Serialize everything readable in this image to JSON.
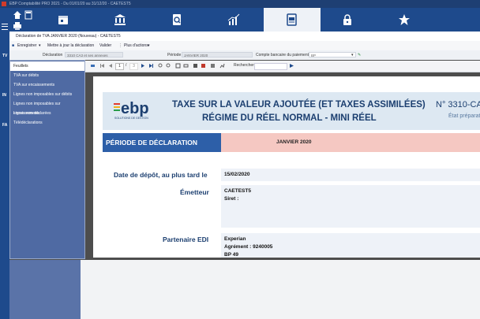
{
  "window": {
    "title": "EBP Comptabilité PRO 2021 - Du 01/01/20 au 31/12/20 - CAETEST5"
  },
  "leftbar": {
    "labels": [
      "TV",
      "IN",
      "FA"
    ]
  },
  "nav": {
    "icons": [
      "calendar-icon",
      "bank-icon",
      "search-document-icon",
      "chart-icon",
      "tva-document-icon",
      "lock-icon",
      "star-icon"
    ],
    "active_index": 4
  },
  "subheader": {
    "title": "Déclaration de TVA JANVIER 2020 (Nouveau) - CAETEST5"
  },
  "actions": {
    "save": "Enregistrer",
    "update": "Mettre à jour la déclaration",
    "validate": "Valider",
    "more": "Plus d'actions"
  },
  "fields": {
    "declaration_label": "Déclaration",
    "declaration_value": "3310 CA3 et ses annexes",
    "period_label": "Période",
    "period_value": "JANVIER 2020",
    "account_label": "Compte bancaire du paiement",
    "account_value": "BP"
  },
  "pdf_toolbar": {
    "page_current": "1",
    "page_sep": "/",
    "page_total": "3",
    "search_label": "Rechercher"
  },
  "menu": {
    "items": [
      "Feuillets",
      "TVA sur débits",
      "TVA sur encaissements",
      "Lignes non imposables sur débits",
      "Lignes non imposables sur encaissements",
      "Lignes non déclarées",
      "Télédéclarations"
    ],
    "selected_index": 0
  },
  "form": {
    "logo_text": "ebp",
    "logo_sub": "SOLUTIONS DE GESTION",
    "title_line1": "TAXE SUR LA VALEUR AJOUTÉE (ET TAXES ASSIMILÉES)",
    "title_line2": "RÉGIME DU RÉEL NORMAL - MINI RÉEL",
    "form_no": "N° 3310-CA",
    "state": "État préparatoi",
    "period_header": "PÉRIODE DE DÉCLARATION",
    "period_value": "JANVIER 2020",
    "deadline_label": "Date de dépôt, au plus tard le",
    "deadline_value": "15/02/2020",
    "emitter_label": "Émetteur",
    "emitter_name": "CAETEST5",
    "emitter_siret": "Siret :",
    "partner_label": "Partenaire EDI",
    "partner_name": "Experian",
    "partner_agreement": "Agrément : 9240005",
    "partner_bp": "BP 49"
  },
  "colors": {
    "nav_blue": "#1e4a8c",
    "period_header_blue": "#2d5fa8",
    "period_value_pink": "#f5c8c2",
    "form_title_blue": "#1c3f70"
  }
}
